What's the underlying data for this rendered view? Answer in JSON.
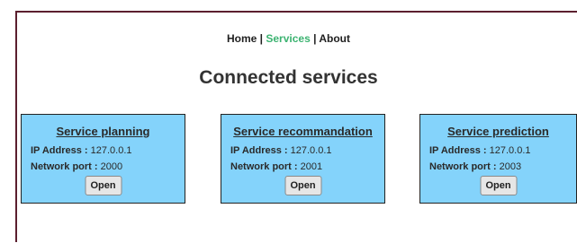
{
  "nav": {
    "home": "Home",
    "sep1": "|",
    "services": "Services",
    "sep2": "|",
    "about": "About",
    "active_color": "#3cb371"
  },
  "page_title": "Connected services",
  "card_color": "#84d3fb",
  "services": [
    {
      "title": "Service planning",
      "ip_label": "IP Address :",
      "ip_value": "127.0.0.1",
      "port_label": "Network port :",
      "port_value": "2000",
      "button": "Open"
    },
    {
      "title": "Service recommandation",
      "ip_label": "IP Address :",
      "ip_value": "127.0.0.1",
      "port_label": "Network port :",
      "port_value": "2001",
      "button": "Open"
    },
    {
      "title": "Service prediction",
      "ip_label": "IP Address :",
      "ip_value": "127.0.0.1",
      "port_label": "Network port :",
      "port_value": "2003",
      "button": "Open"
    }
  ]
}
